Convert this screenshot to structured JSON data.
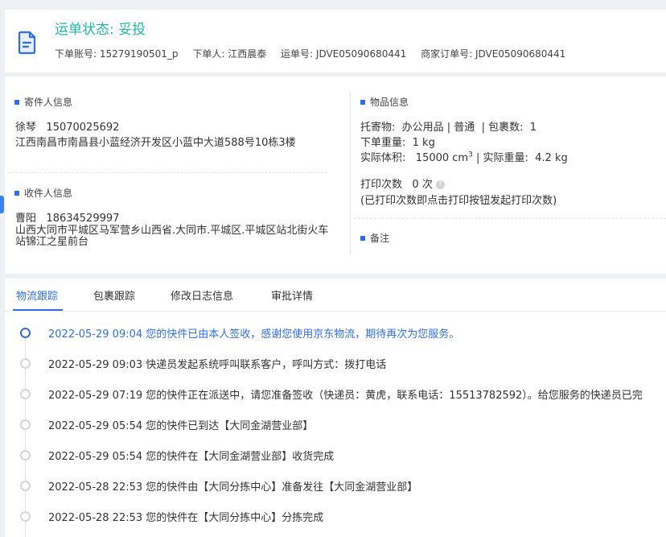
{
  "header": {
    "status_title": "运单状态: 妥投",
    "meta": [
      {
        "label": "下单账号:",
        "value": "15279190501_p"
      },
      {
        "label": "下单人:",
        "value": "江西晨泰"
      },
      {
        "label": "运单号:",
        "value": "JDVE05090680441"
      },
      {
        "label": "商家订单号:",
        "value": "JDVE05090680441"
      }
    ]
  },
  "sender": {
    "section_title": "寄件人信息",
    "name": "徐琴",
    "phone": "15070025692",
    "address": "江西南昌市南昌县小蓝经济开发区小蓝中大道588号10栋3楼"
  },
  "receiver": {
    "section_title": "收件人信息",
    "name": "曹阳",
    "phone": "18634529997",
    "address": "山西大同市平城区马军营乡山西省.大同市.平城区.平城区站北街火车站锦江之星前台"
  },
  "goods": {
    "section_title": "物品信息",
    "line1_label": "托寄物:",
    "line1_value": "办公用品 | 普通",
    "line1_pkg_label": "| 包裹数:",
    "line1_pkg_value": "1",
    "weight_label": "下单重量:",
    "weight_value": "1 kg",
    "volume_label": "实际体积:",
    "volume_value": "15000 cm",
    "volume_unit_sup": "3",
    "actual_weight_label": "| 实际重量:",
    "actual_weight_value": "4.2 kg",
    "print_label": "打印次数",
    "print_value": "0 次",
    "print_help_glyph": "?",
    "print_note": "(已打印次数即点击打印按钮发起打印次数)"
  },
  "remark": {
    "section_title": "备注"
  },
  "tabs": [
    {
      "label": "物流跟踪"
    },
    {
      "label": "包裹跟踪"
    },
    {
      "label": "修改日志信息"
    },
    {
      "label": "审批详情"
    }
  ],
  "timeline": [
    {
      "time": "2022-05-29 09:04",
      "text": "您的快件已由本人签收，感谢您使用京东物流，期待再次为您服务。"
    },
    {
      "time": "2022-05-29 09:03",
      "text": "快递员发起系统呼叫联系客户，呼叫方式：拨打电话"
    },
    {
      "time": "2022-05-29 07:19",
      "text": "您的快件正在派送中，请您准备签收（快递员：黄虎，联系电话：15513782592）。给您服务的快递员已完"
    },
    {
      "time": "2022-05-29 05:54",
      "text": "您的快件已到达【大同金湖营业部】"
    },
    {
      "time": "2022-05-29 05:54",
      "text": "您的快件在【大同金湖营业部】收货完成"
    },
    {
      "time": "2022-05-28 22:53",
      "text": "您的快件由【大同分拣中心】准备发往【大同金湖营业部】"
    },
    {
      "time": "2022-05-28 22:53",
      "text": "您的快件在【大同分拣中心】分拣完成"
    }
  ],
  "colors": {
    "accent_blue": "#2f6ee6",
    "status_teal": "#22b8a4"
  }
}
